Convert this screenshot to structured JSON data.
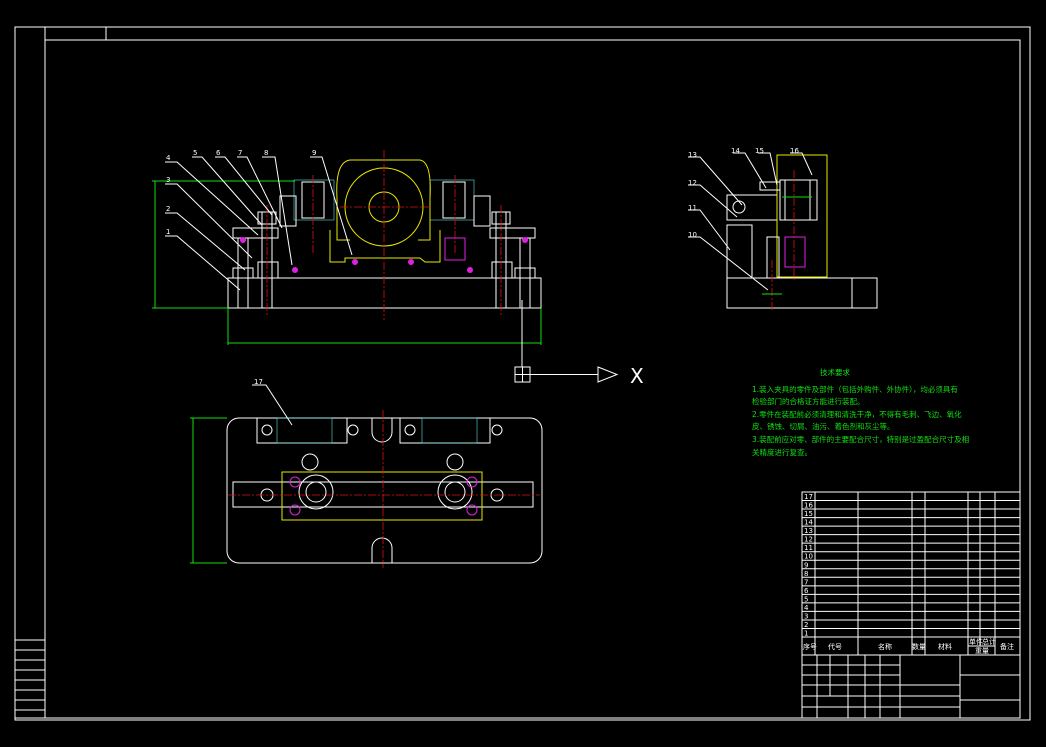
{
  "drawing": {
    "front_view_labels": [
      "1",
      "2",
      "3",
      "4",
      "5",
      "6",
      "7",
      "8",
      "9"
    ],
    "side_view_labels": [
      "10",
      "11",
      "12",
      "13",
      "14",
      "15",
      "16"
    ],
    "top_view_labels": [
      "17"
    ],
    "axis_label": "X"
  },
  "tech_requirements": {
    "title": "技术要求",
    "lines": [
      "1.装入夹具的零件及部件（包括外购件、外协件），均必须具有",
      "检验部门的合格证方能进行装配。",
      "2.零件在装配前必须清理和清洗干净，不得有毛刺、飞边、氧化",
      "皮、锈蚀、切屑、油污、着色剂和灰尘等。",
      "3.装配前应对零、部件的主要配合尺寸，特别是过盈配合尺寸及相",
      "关精度进行复查。"
    ]
  },
  "bom": {
    "row_numbers": [
      "17",
      "16",
      "15",
      "14",
      "13",
      "12",
      "11",
      "10",
      "9",
      "8",
      "7",
      "6",
      "5",
      "4",
      "3",
      "2",
      "1"
    ],
    "headers": {
      "no": "序号",
      "code": "代号",
      "name": "名称",
      "qty": "数量",
      "material": "材料",
      "single": "单件",
      "total": "总计",
      "weight": "重量",
      "remark": "备注"
    }
  },
  "colors": {
    "background": "#000000",
    "outline": "#ffffff",
    "hatch": "#5fe0e0",
    "part": "#e8e800",
    "centerline": "#e01010",
    "dimension": "#10e010",
    "bolt": "#e020e0"
  }
}
